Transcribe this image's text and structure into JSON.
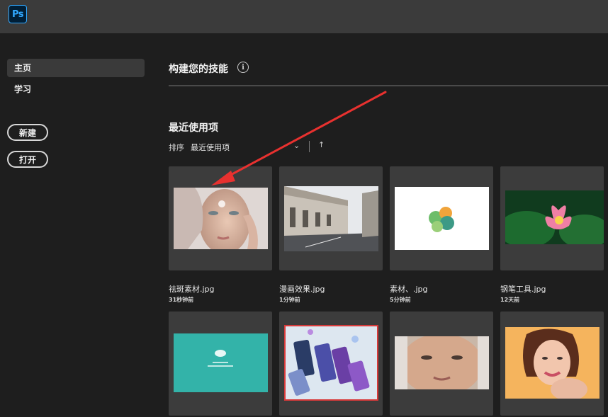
{
  "app": {
    "logo_text": "Ps"
  },
  "sidebar": {
    "items": [
      {
        "label": "主页",
        "active": true
      },
      {
        "label": "学习",
        "active": false
      }
    ],
    "new_label": "新建",
    "open_label": "打开"
  },
  "main": {
    "build_skills_title": "构建您的技能",
    "info_glyph": "i",
    "recent_title": "最近使用项",
    "sort_label": "排序",
    "sort_value": "最近使用项",
    "sort_chevron": "⌄",
    "sort_direction_glyph": "↑"
  },
  "files": [
    {
      "name": "祛斑素材.jpg",
      "time": "31秒钟前"
    },
    {
      "name": "漫画效果.jpg",
      "time": "1分钟前"
    },
    {
      "name": "素材、.jpg",
      "time": "5分钟前"
    },
    {
      "name": "钢笔工具.jpg",
      "time": "12天前"
    },
    {
      "name": "",
      "time": ""
    },
    {
      "name": "",
      "time": ""
    },
    {
      "name": "",
      "time": ""
    },
    {
      "name": "",
      "time": ""
    }
  ],
  "colors": {
    "accent_arrow": "#e8312f",
    "ps_blue": "#31a8ff"
  }
}
